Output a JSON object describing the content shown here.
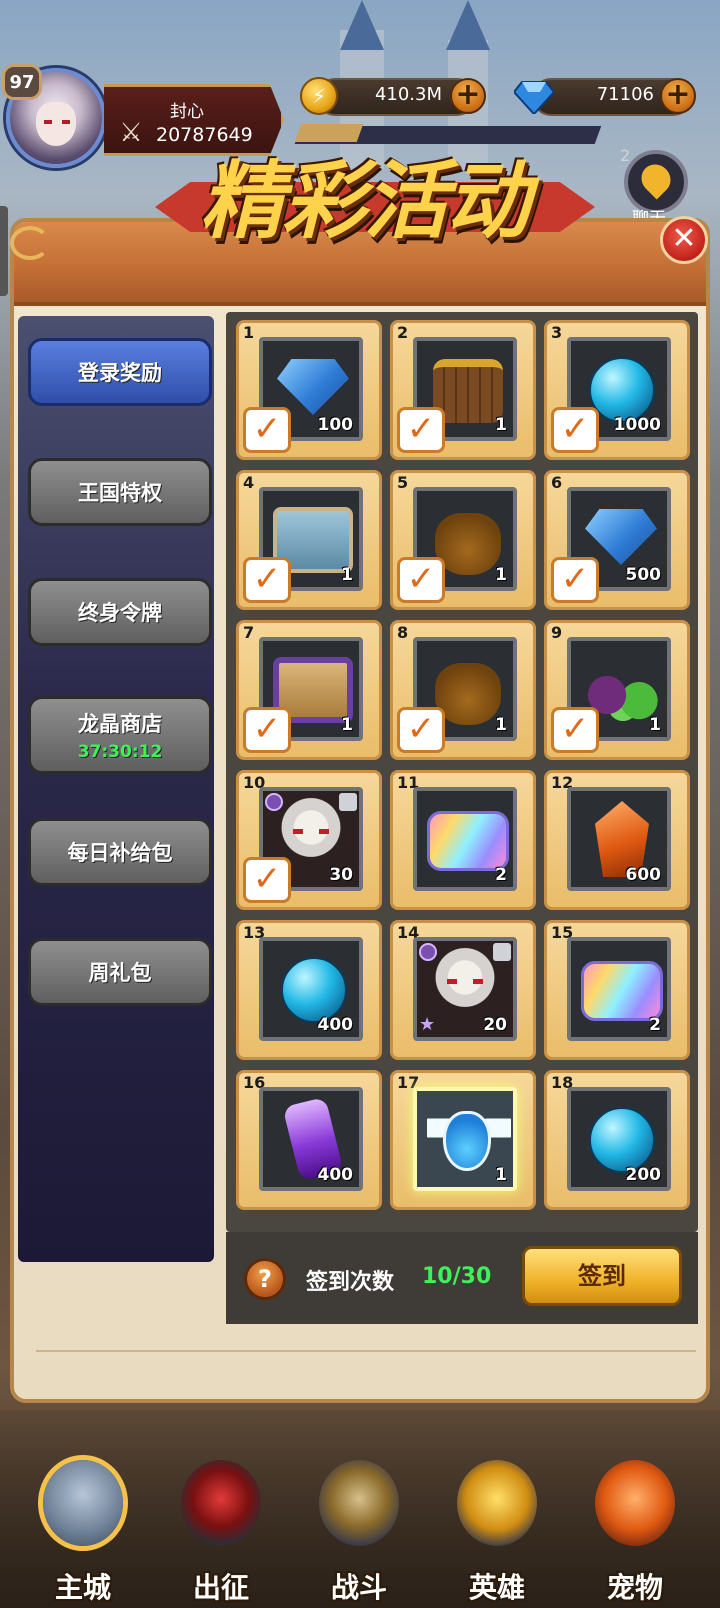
{
  "player": {
    "level": "97",
    "name": "封心",
    "power": "20787649"
  },
  "resources": {
    "gold": "410.3M",
    "gems": "71106"
  },
  "chat": {
    "label": "聊天",
    "time": "2"
  },
  "banner": {
    "title": "精彩活动"
  },
  "sidebar": {
    "items": [
      {
        "label": "登录奖励",
        "active": true
      },
      {
        "label": "王国特权"
      },
      {
        "label": "终身令牌"
      },
      {
        "label": "龙晶商店",
        "timer": "37:30:12"
      },
      {
        "label": "每日补给包"
      },
      {
        "label": "周礼包"
      }
    ]
  },
  "rewards": [
    {
      "day": "1",
      "item": "gem-icon",
      "qty": "100",
      "claimed": true
    },
    {
      "day": "2",
      "item": "gold-barrel-icon",
      "qty": "1",
      "claimed": true
    },
    {
      "day": "3",
      "item": "blue-orb-icon",
      "qty": "1000",
      "claimed": true
    },
    {
      "day": "4",
      "item": "blue-chest-icon",
      "qty": "1",
      "claimed": true
    },
    {
      "day": "5",
      "item": "gold-bag-icon",
      "qty": "1",
      "claimed": true
    },
    {
      "day": "6",
      "item": "gem-icon",
      "qty": "500",
      "claimed": true
    },
    {
      "day": "7",
      "item": "purple-chest-icon",
      "qty": "1",
      "claimed": true
    },
    {
      "day": "8",
      "item": "gold-bag-icon",
      "qty": "1",
      "claimed": true
    },
    {
      "day": "9",
      "item": "potions-icon",
      "qty": "1",
      "claimed": true
    },
    {
      "day": "10",
      "item": "hero-shard-icon",
      "qty": "30",
      "claimed": true
    },
    {
      "day": "11",
      "item": "rainbow-chest-icon",
      "qty": "2",
      "claimed": false
    },
    {
      "day": "12",
      "item": "fire-crystal-icon",
      "qty": "600",
      "claimed": false
    },
    {
      "day": "13",
      "item": "blue-orb-icon",
      "qty": "400",
      "claimed": false
    },
    {
      "day": "14",
      "item": "hero-shard-icon",
      "qty": "20",
      "claimed": false
    },
    {
      "day": "15",
      "item": "rainbow-chest-icon",
      "qty": "2",
      "claimed": false
    },
    {
      "day": "16",
      "item": "purple-vial-icon",
      "qty": "400",
      "claimed": false
    },
    {
      "day": "17",
      "item": "winged-flask-icon",
      "qty": "1",
      "claimed": false,
      "highlighted": true
    },
    {
      "day": "18",
      "item": "blue-orb-icon",
      "qty": "200",
      "claimed": false
    }
  ],
  "signin": {
    "label": "签到次数",
    "count": "10/30",
    "button": "签到",
    "help": "?"
  },
  "nav": {
    "items": [
      {
        "label": "主城",
        "icon": "castle-tower-icon",
        "active": true
      },
      {
        "label": "出征",
        "icon": "red-crystal-icon"
      },
      {
        "label": "战斗",
        "icon": "crossed-swords-icon"
      },
      {
        "label": "英雄",
        "icon": "golden-helmet-icon"
      },
      {
        "label": "宠物",
        "icon": "dragon-pet-icon"
      }
    ]
  },
  "colors": {
    "accent_gold": "#f0b22a",
    "active_tab": "#2e4ea8",
    "timer_green": "#3ef05a",
    "close_red": "#c0221a"
  }
}
